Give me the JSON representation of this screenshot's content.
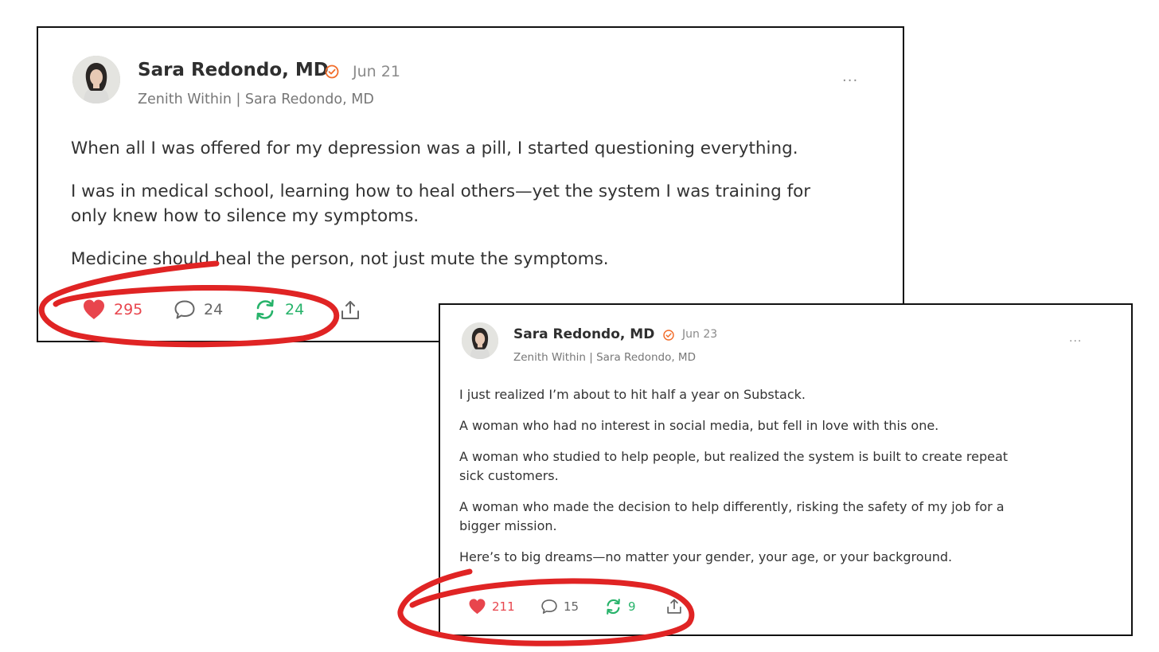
{
  "colors": {
    "like": "#e8454d",
    "restack": "#27b36a",
    "verified": "#f26d2b",
    "highlight_marker": "#e02424"
  },
  "notes": [
    {
      "author": "Sara Redondo, MD",
      "date": "Jun 21",
      "publication": "Zenith Within | Sara Redondo, MD",
      "more_icon": "···",
      "paragraphs": [
        "When all I was offered for my depression was a pill, I started questioning everything.",
        "I was in medical school, learning how to heal others—yet the system I was training for",
        "only knew how to silence my symptoms.",
        "Medicine should heal the person, not just mute the symptoms."
      ],
      "likes": "295",
      "comments": "24",
      "restacks": "24"
    },
    {
      "author": "Sara Redondo, MD",
      "date": "Jun 23",
      "publication": "Zenith Within | Sara Redondo, MD",
      "more_icon": "···",
      "paragraphs": [
        "I just realized I’m about to hit half a year on Substack.",
        "A woman who had no interest in social media, but fell in love with this one.",
        "A woman who studied to help people, but realized the system is built to create repeat",
        "sick customers.",
        "A woman who made the decision to help differently, risking the safety of my job for a",
        "bigger mission.",
        "Here’s to big dreams—no matter your gender, your age, or your background."
      ],
      "likes": "211",
      "comments": "15",
      "restacks": "9"
    }
  ]
}
